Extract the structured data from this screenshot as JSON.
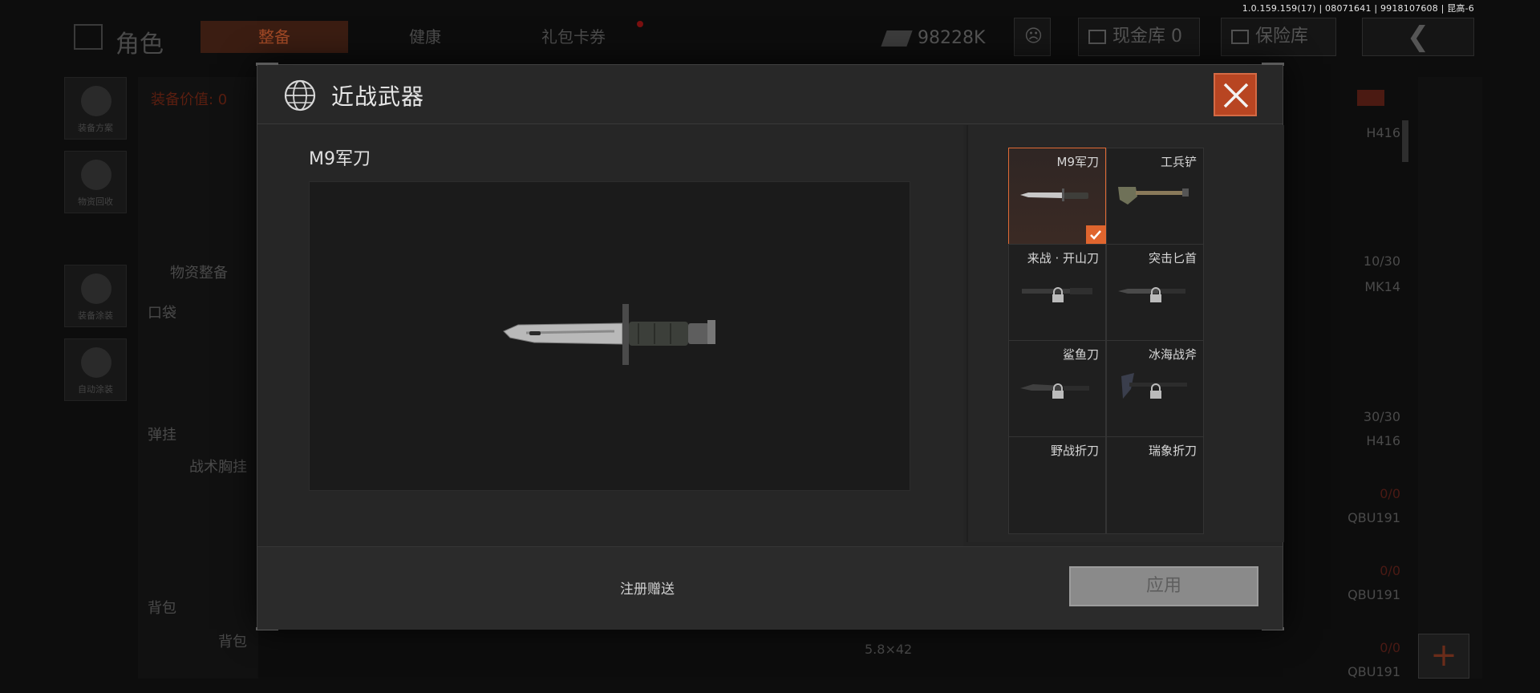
{
  "version": "1.0.159.159(17) | 08071641 | 9918107608 | 昆高-6",
  "background": {
    "title": "角色",
    "tabs": [
      "整备",
      "健康",
      "礼包卡券"
    ],
    "money": "98228K",
    "cash_vault": "现金库 0",
    "safe_box": "保险库",
    "sidebar": [
      "装备方案",
      "物资回收",
      "装备涂装",
      "自动涂装"
    ],
    "equip_value_label": "装备价值: 0",
    "supply_label": "物资整备",
    "left_labels": [
      "口袋",
      "弹挂",
      "战术胸挂",
      "背包",
      "背包"
    ],
    "right_items": [
      {
        "text": "H416",
        "style": "grey"
      },
      {
        "text": "10/30",
        "style": "grey"
      },
      {
        "text": "MK14",
        "style": "grey"
      },
      {
        "text": "30/30",
        "style": "grey"
      },
      {
        "text": "H416",
        "style": "grey"
      },
      {
        "text": "0/0",
        "style": "red"
      },
      {
        "text": "QBU191",
        "style": "grey"
      },
      {
        "text": "0/0",
        "style": "red"
      },
      {
        "text": "QBU191",
        "style": "grey"
      },
      {
        "text": "0/0",
        "style": "red"
      },
      {
        "text": "QBU191",
        "style": "grey"
      }
    ],
    "caliber": "5.8×42"
  },
  "modal": {
    "title": "近战武器",
    "selected_weapon": "M9军刀",
    "weapons": [
      {
        "name": "M9军刀",
        "selected": true,
        "locked": false,
        "icon": "knife-icon"
      },
      {
        "name": "工兵铲",
        "selected": false,
        "locked": false,
        "icon": "shovel-icon"
      },
      {
        "name": "来战 · 开山刀",
        "selected": false,
        "locked": true,
        "icon": "machete-icon"
      },
      {
        "name": "突击匕首",
        "selected": false,
        "locked": true,
        "icon": "dagger-icon"
      },
      {
        "name": "鲨鱼刀",
        "selected": false,
        "locked": true,
        "icon": "shark-knife-icon"
      },
      {
        "name": "冰海战斧",
        "selected": false,
        "locked": true,
        "icon": "axe-icon"
      },
      {
        "name": "野战折刀",
        "selected": false,
        "locked": true,
        "icon": "folding-knife-icon"
      },
      {
        "name": "瑞象折刀",
        "selected": false,
        "locked": true,
        "icon": "folding-knife-icon"
      }
    ],
    "footer_text": "注册赠送",
    "apply_label": "应用"
  },
  "colors": {
    "accent": "#e0652e",
    "close_bg": "#b84522"
  }
}
